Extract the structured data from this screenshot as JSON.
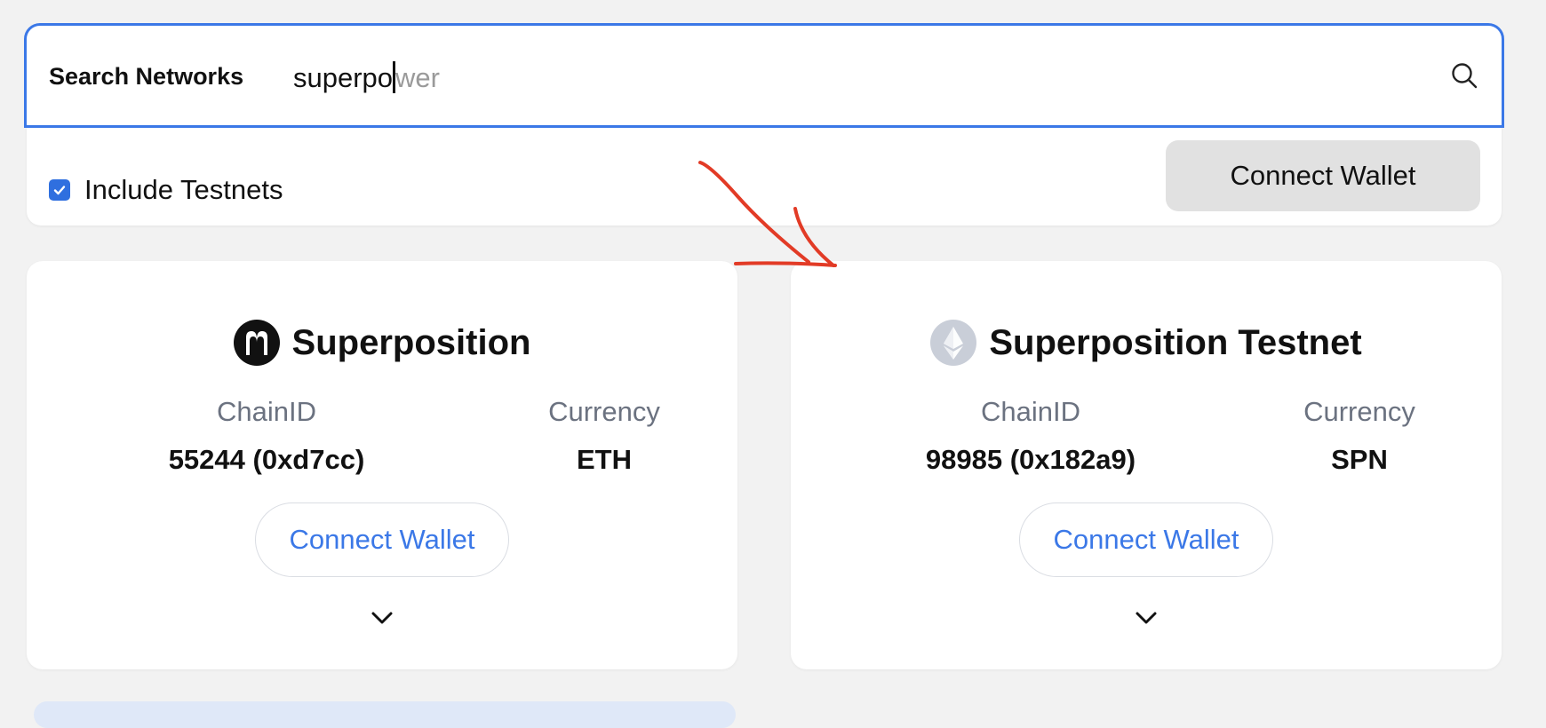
{
  "search": {
    "label": "Search Networks",
    "typed": "superpo",
    "suggestion": "wer",
    "icon": "search-icon"
  },
  "filters": {
    "include_testnets_label": "Include Testnets",
    "include_testnets_checked": true
  },
  "toolbar": {
    "connect_label": "Connect Wallet"
  },
  "networks": [
    {
      "name": "Superposition",
      "icon": "superposition-logo-icon",
      "chain_label": "ChainID",
      "chain_value": "55244 (0xd7cc)",
      "currency_label": "Currency",
      "currency_value": "ETH",
      "connect_label": "Connect Wallet",
      "expand_icon": "chevron-down-icon"
    },
    {
      "name": "Superposition Testnet",
      "icon": "ethereum-logo-icon",
      "chain_label": "ChainID",
      "chain_value": "98985 (0x182a9)",
      "currency_label": "Currency",
      "currency_value": "SPN",
      "connect_label": "Connect Wallet",
      "expand_icon": "chevron-down-icon"
    }
  ],
  "colors": {
    "accent": "#3b78e7",
    "annotation": "#e23b26",
    "muted_text": "#6b7280",
    "background": "#f2f2f2"
  }
}
